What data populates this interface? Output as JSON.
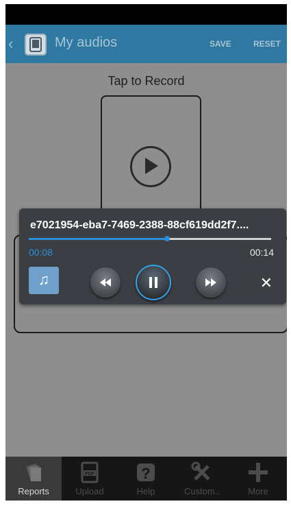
{
  "header": {
    "title": "My audios",
    "save_label": "SAVE",
    "reset_label": "RESET",
    "back_icon": "chevron-left-icon",
    "app_icon": "tablet-icon"
  },
  "content": {
    "tap_label": "Tap to Record",
    "play_icon": "play-circle-icon"
  },
  "player": {
    "track_title": "e7021954-eba7-7469-2388-88cf619dd2f7....",
    "current_time": "00:08",
    "total_time": "00:14",
    "progress": 0.57,
    "close_label": "✕",
    "note_label": "♫",
    "accent_color": "#2a8fd6"
  },
  "bottom_nav": {
    "items": [
      {
        "label": "Reports",
        "icon": "reports-icon",
        "active": true
      },
      {
        "label": "Upload",
        "icon": "pdf-upload-icon",
        "active": false
      },
      {
        "label": "Help",
        "icon": "help-icon",
        "active": false
      },
      {
        "label": "Custom..",
        "icon": "tools-icon",
        "active": false
      },
      {
        "label": "More",
        "icon": "plus-icon",
        "active": false
      }
    ]
  }
}
